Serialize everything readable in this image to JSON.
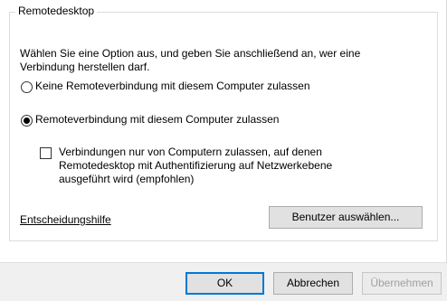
{
  "group": {
    "title": "Remotedesktop"
  },
  "description": "Wählen Sie eine Option aus, und geben Sie anschließend an, wer eine Verbindung herstellen darf.",
  "options": [
    {
      "label": "Keine Remoteverbindung mit diesem Computer zulassen",
      "selected": false
    },
    {
      "label": "Remoteverbindung mit diesem Computer zulassen",
      "selected": true
    }
  ],
  "nla_checkbox": {
    "label": "Verbindungen nur von Computern zulassen, auf denen Remotedesktop mit Authentifizierung auf Netzwerkebene ausgeführt wird (empfohlen)",
    "checked": false
  },
  "help_link": "Entscheidungshilfe",
  "select_users_button": "Benutzer auswählen...",
  "footer": {
    "ok": "OK",
    "cancel": "Abbrechen",
    "apply": "Übernehmen"
  }
}
